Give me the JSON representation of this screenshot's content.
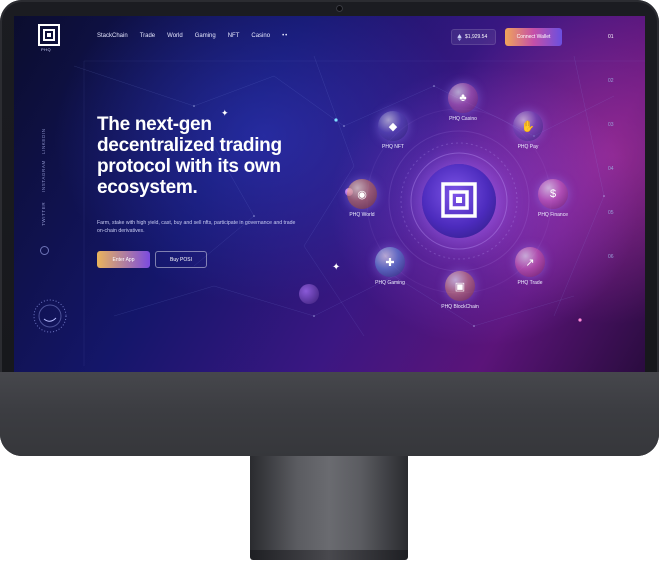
{
  "logo": {
    "text": "PHQ"
  },
  "nav": {
    "items": [
      "StackChain",
      "Trade",
      "World",
      "Gaming",
      "NFT",
      "Casino"
    ],
    "more": "••"
  },
  "wallet": {
    "price": "$1,929.54",
    "connect_label": "Connect Wallet"
  },
  "pagination": [
    "01",
    "02",
    "03",
    "04",
    "05",
    "06"
  ],
  "socials": [
    "LINKEDIN",
    "INSTAGRAM",
    "TWITTER"
  ],
  "hero": {
    "headline": "The next-gen decentralized trading protocol with its own ecosystem.",
    "subtext": "Farm, stake with high yield, cast, buy and sell nfts, participate in governance and trade on-chain derivatives.",
    "enter_label": "Enter App",
    "buy_label": "Buy POSI"
  },
  "nodes": {
    "nft": "PHQ NFT",
    "casino": "PHQ Casino",
    "pay": "PHQ Pay",
    "world": "PHQ World",
    "finance": "PHQ Finance",
    "gaming": "PHQ Gaming",
    "trade": "PHQ Trade",
    "blockchain": "PHQ BlockChain"
  },
  "colors": {
    "accent": "#7b4be0",
    "brand_gold": "#e9b45c",
    "node_pink": "#c54fa8"
  },
  "icons": [
    "logo-icon",
    "eth-icon",
    "casino-icon",
    "nft-icon",
    "pay-icon",
    "world-icon",
    "finance-icon",
    "gaming-icon",
    "trade-icon",
    "blockchain-icon",
    "sparkle-icon",
    "dial-icon"
  ]
}
